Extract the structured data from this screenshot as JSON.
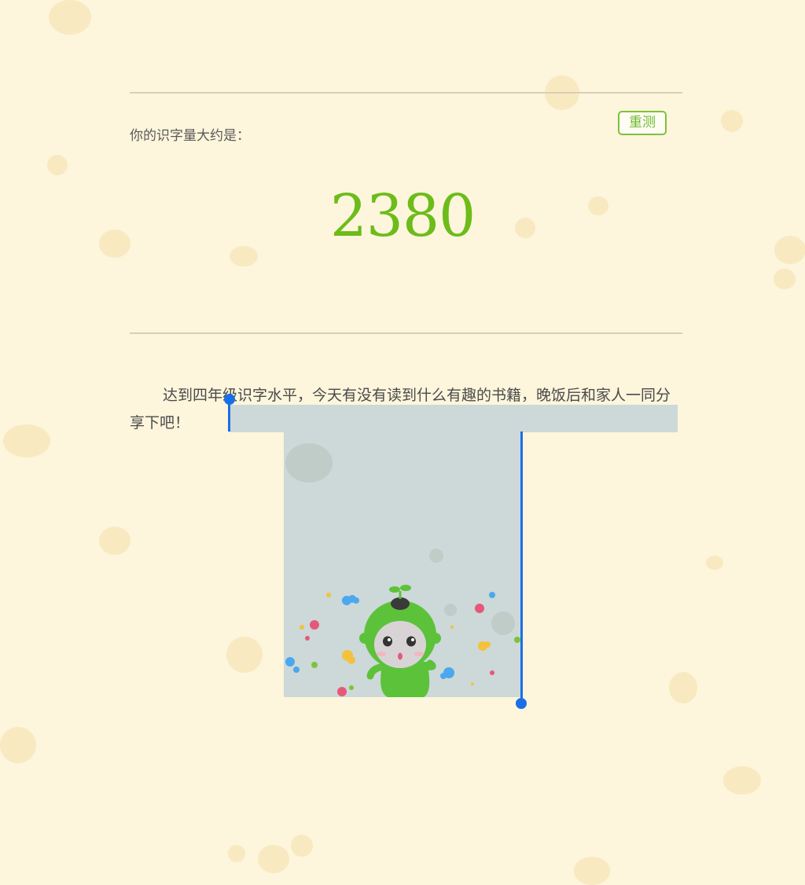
{
  "result": {
    "label": "你的识字量大约是：",
    "count": "2380",
    "retest_button": "重测"
  },
  "message": {
    "text": "达到四年级识字水平，今天有没有读到什么有趣的书籍，晚饭后和家人一同分享下吧！"
  },
  "selection": {
    "state": "text selected (from '下' through the mascot image)"
  },
  "mascot": {
    "icon": "green-sprout-mascot-icon"
  },
  "colors": {
    "background": "#fdf5dc",
    "accent_green": "#6cbc1a",
    "selection": "#cdd8d8",
    "selection_handle": "#1a6fe6"
  }
}
